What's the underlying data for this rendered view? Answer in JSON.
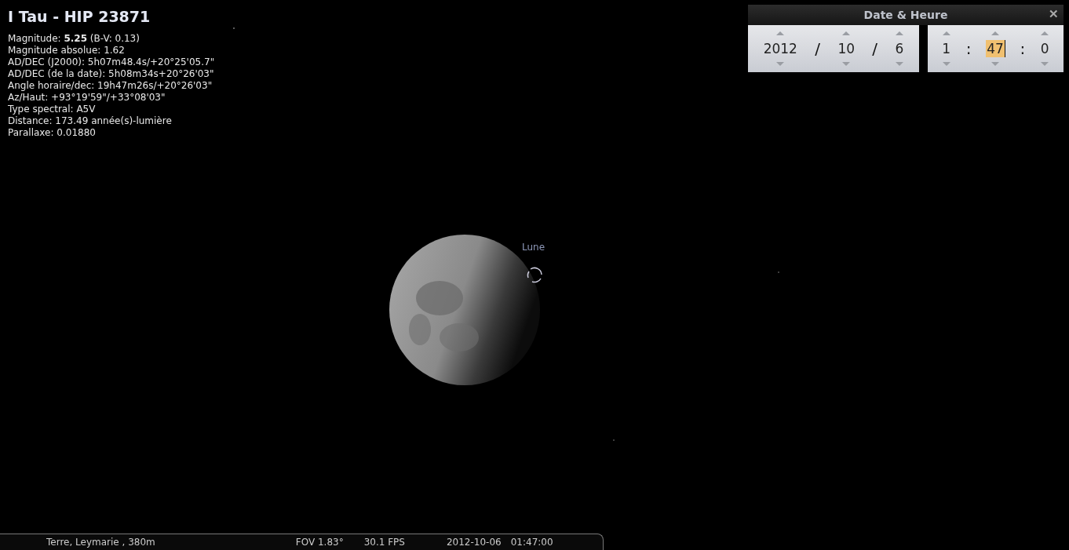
{
  "object_info": {
    "title": "I Tau - HIP 23871",
    "lines": [
      "Magnitude: **5.25** (B-V: 0.13)",
      "Magnitude absolue: 1.62",
      "AD/DEC (J2000): 5h07m48.4s/+20°25'05.7\"",
      "AD/DEC (de la date): 5h08m34s+20°26'03\"",
      "Angle horaire/dec: 19h47m26s/+20°26'03\"",
      "Az/Haut: +93°19'59\"/+33°08'03\"",
      "Type spectral: A5V",
      "Distance: 173.49 année(s)-lumière",
      "Parallaxe: 0.01880"
    ]
  },
  "date_time_window": {
    "title": "Date & Heure",
    "close": "✕",
    "date": {
      "fields": [
        {
          "value": "2012",
          "selected": false
        },
        {
          "value": "10",
          "selected": false
        },
        {
          "value": "6",
          "selected": false
        }
      ],
      "separator": "/"
    },
    "time": {
      "fields": [
        {
          "value": "1",
          "selected": false
        },
        {
          "value": "47",
          "selected": true
        },
        {
          "value": "0",
          "selected": false
        }
      ],
      "separator": ":"
    }
  },
  "sky": {
    "moon_label": "Lune"
  },
  "status_bar": {
    "location": "Terre, Leymarie , 380m",
    "fov": "FOV 1.83°",
    "fps": "30.1 FPS",
    "date": "2012-10-06",
    "time": "01:47:00"
  }
}
